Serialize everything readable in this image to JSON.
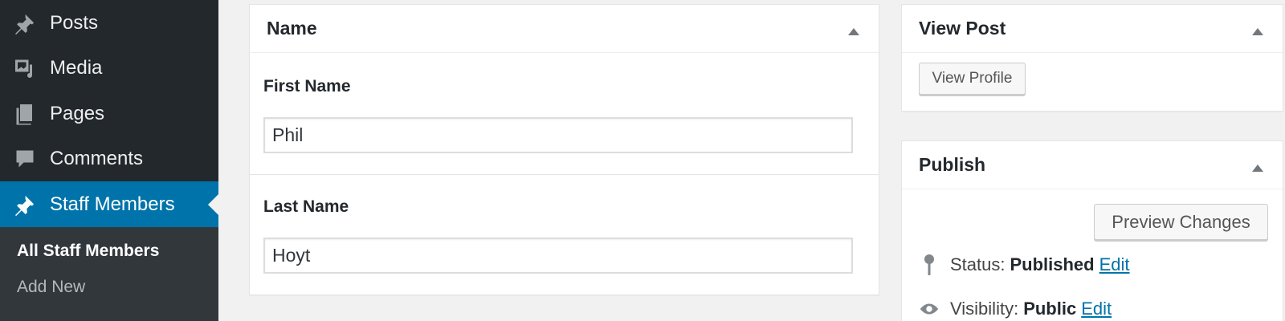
{
  "sidebar": {
    "items": [
      {
        "label": "Posts",
        "icon": "pin-icon"
      },
      {
        "label": "Media",
        "icon": "media-icon"
      },
      {
        "label": "Pages",
        "icon": "pages-icon"
      },
      {
        "label": "Comments",
        "icon": "comment-icon"
      },
      {
        "label": "Staff Members",
        "icon": "pin-icon",
        "active": true
      }
    ],
    "submenu": [
      {
        "label": "All Staff Members",
        "current": true
      },
      {
        "label": "Add New"
      }
    ]
  },
  "name_box": {
    "title": "Name",
    "first_name_label": "First Name",
    "first_name_value": "Phil",
    "last_name_label": "Last Name",
    "last_name_value": "Hoyt"
  },
  "view_post_box": {
    "title": "View Post",
    "button_label": "View Profile"
  },
  "publish_box": {
    "title": "Publish",
    "preview_button": "Preview Changes",
    "status_label": "Status:",
    "status_value": "Published",
    "status_edit": "Edit",
    "visibility_label": "Visibility:",
    "visibility_value": "Public",
    "visibility_edit": "Edit"
  },
  "colors": {
    "sidebar_bg": "#23282d",
    "submenu_bg": "#32373c",
    "accent": "#0073aa",
    "page_bg": "#f1f1f1"
  }
}
